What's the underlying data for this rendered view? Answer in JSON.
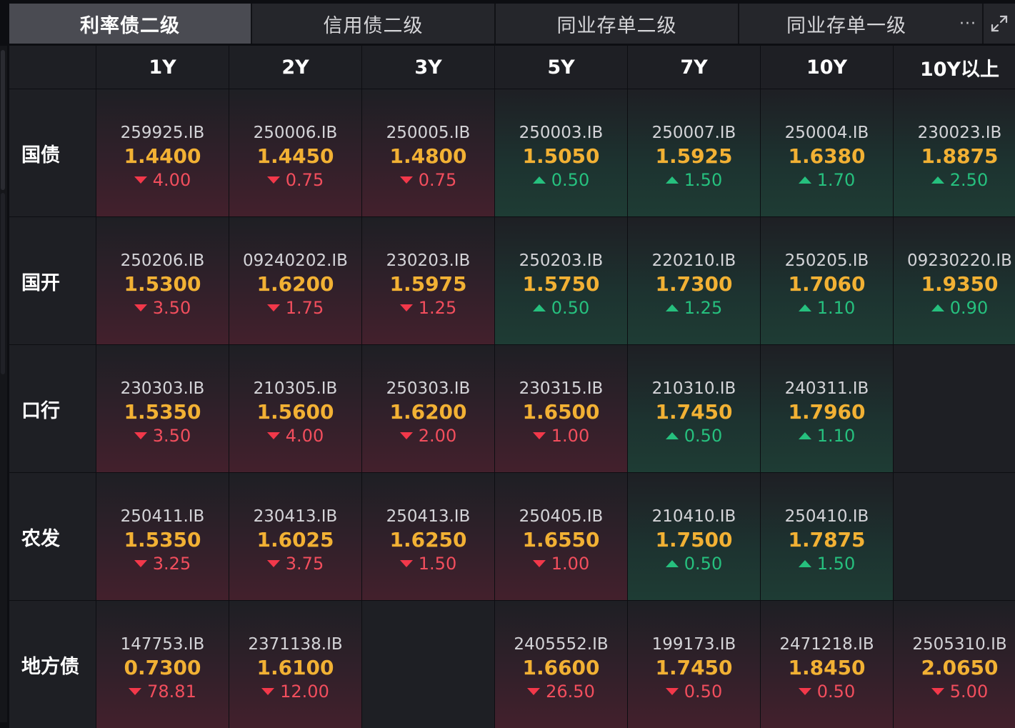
{
  "tabs": [
    "利率债二级",
    "信用债二级",
    "同业存单二级",
    "同业存单一级"
  ],
  "more_label": "···",
  "columns": [
    "1Y",
    "2Y",
    "3Y",
    "5Y",
    "7Y",
    "10Y",
    "10Y以上"
  ],
  "colors": {
    "yield": "#f2b134",
    "down": "#f24e5d",
    "up": "#26c07e"
  },
  "rows": [
    {
      "label": "国债",
      "cells": [
        {
          "code": "259925.IB",
          "yield": "1.4400",
          "change": "4.00",
          "dir": "down"
        },
        {
          "code": "250006.IB",
          "yield": "1.4450",
          "change": "0.75",
          "dir": "down"
        },
        {
          "code": "250005.IB",
          "yield": "1.4800",
          "change": "0.75",
          "dir": "down"
        },
        {
          "code": "250003.IB",
          "yield": "1.5050",
          "change": "0.50",
          "dir": "up"
        },
        {
          "code": "250007.IB",
          "yield": "1.5925",
          "change": "1.50",
          "dir": "up"
        },
        {
          "code": "250004.IB",
          "yield": "1.6380",
          "change": "1.70",
          "dir": "up"
        },
        {
          "code": "230023.IB",
          "yield": "1.8875",
          "change": "2.50",
          "dir": "up"
        }
      ]
    },
    {
      "label": "国开",
      "cells": [
        {
          "code": "250206.IB",
          "yield": "1.5300",
          "change": "3.50",
          "dir": "down"
        },
        {
          "code": "09240202.IB",
          "yield": "1.6200",
          "change": "1.75",
          "dir": "down"
        },
        {
          "code": "230203.IB",
          "yield": "1.5975",
          "change": "1.25",
          "dir": "down"
        },
        {
          "code": "250203.IB",
          "yield": "1.5750",
          "change": "0.50",
          "dir": "up"
        },
        {
          "code": "220210.IB",
          "yield": "1.7300",
          "change": "1.25",
          "dir": "up"
        },
        {
          "code": "250205.IB",
          "yield": "1.7060",
          "change": "1.10",
          "dir": "up"
        },
        {
          "code": "09230220.IB",
          "yield": "1.9350",
          "change": "0.90",
          "dir": "up"
        }
      ]
    },
    {
      "label": "口行",
      "cells": [
        {
          "code": "230303.IB",
          "yield": "1.5350",
          "change": "3.50",
          "dir": "down"
        },
        {
          "code": "210305.IB",
          "yield": "1.5600",
          "change": "4.00",
          "dir": "down"
        },
        {
          "code": "250303.IB",
          "yield": "1.6200",
          "change": "2.00",
          "dir": "down"
        },
        {
          "code": "230315.IB",
          "yield": "1.6500",
          "change": "1.00",
          "dir": "down"
        },
        {
          "code": "210310.IB",
          "yield": "1.7450",
          "change": "0.50",
          "dir": "up"
        },
        {
          "code": "240311.IB",
          "yield": "1.7960",
          "change": "1.10",
          "dir": "up"
        },
        null
      ]
    },
    {
      "label": "农发",
      "cells": [
        {
          "code": "250411.IB",
          "yield": "1.5350",
          "change": "3.25",
          "dir": "down"
        },
        {
          "code": "230413.IB",
          "yield": "1.6025",
          "change": "3.75",
          "dir": "down"
        },
        {
          "code": "250413.IB",
          "yield": "1.6250",
          "change": "1.50",
          "dir": "down"
        },
        {
          "code": "250405.IB",
          "yield": "1.6550",
          "change": "1.00",
          "dir": "down"
        },
        {
          "code": "210410.IB",
          "yield": "1.7500",
          "change": "0.50",
          "dir": "up"
        },
        {
          "code": "250410.IB",
          "yield": "1.7875",
          "change": "1.50",
          "dir": "up"
        },
        null
      ]
    },
    {
      "label": "地方债",
      "cells": [
        {
          "code": "147753.IB",
          "yield": "0.7300",
          "change": "78.81",
          "dir": "down"
        },
        {
          "code": "2371138.IB",
          "yield": "1.6100",
          "change": "12.00",
          "dir": "down"
        },
        null,
        {
          "code": "2405552.IB",
          "yield": "1.6600",
          "change": "26.50",
          "dir": "down"
        },
        {
          "code": "199173.IB",
          "yield": "1.7450",
          "change": "0.50",
          "dir": "down"
        },
        {
          "code": "2471218.IB",
          "yield": "1.8450",
          "change": "0.50",
          "dir": "down"
        },
        {
          "code": "2505310.IB",
          "yield": "2.0650",
          "change": "5.00",
          "dir": "down"
        }
      ]
    }
  ]
}
